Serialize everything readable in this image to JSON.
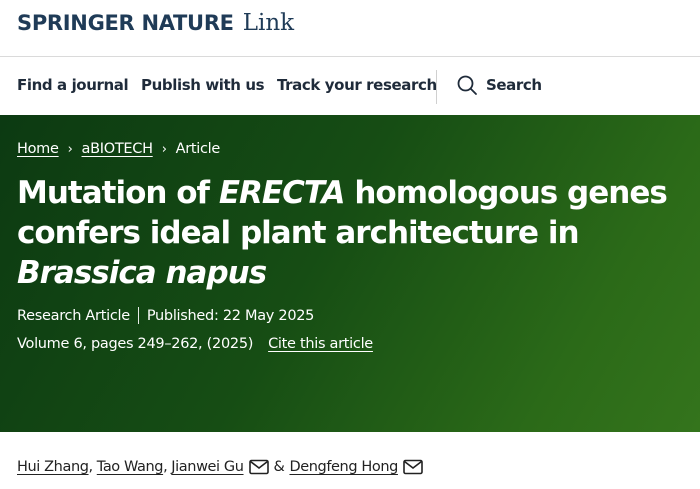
{
  "brand": {
    "springer": "SPRINGER NATURE",
    "link": "Link"
  },
  "nav": {
    "find_journal": "Find a journal",
    "publish": "Publish with us",
    "track": "Track your research",
    "search": "Search"
  },
  "breadcrumb": {
    "home": "Home",
    "journal": "aBIOTECH",
    "current": "Article",
    "separator": "›"
  },
  "article": {
    "title_part1": "Mutation of ",
    "title_gene": "ERECTA",
    "title_part2": " homologous genes confers ideal plant architecture in ",
    "title_species": "Brassica napus",
    "type": "Research Article",
    "published": "Published: 22 May 2025",
    "volume": "Volume 6, pages 249–262, (2025)",
    "cite": "Cite this article"
  },
  "authors": {
    "list": [
      "Hui Zhang",
      "Tao Wang",
      "Jianwei Gu",
      "Dengfeng Hong"
    ],
    "comma": ",",
    "and": "&"
  },
  "icons": {
    "search": "search-icon",
    "mail": "mail-icon"
  },
  "colors": {
    "brand": "#1f3b57",
    "hero_start": "#0c3a12",
    "hero_end": "#34741c"
  }
}
